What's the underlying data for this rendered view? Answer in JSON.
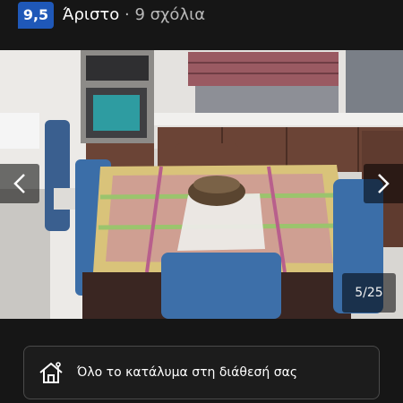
{
  "header": {
    "score": "9,5",
    "rating_word": "Άριστο",
    "separator": "·",
    "reviews": "9 σχόλια"
  },
  "gallery": {
    "counter": "5/25",
    "icons": {
      "prev": "chevron-left-icon",
      "next": "chevron-right-icon"
    }
  },
  "feature": {
    "text": "Όλο το κατάλυμα στη διάθεσή σας",
    "icon": "house-key-icon"
  },
  "colors": {
    "score_badge": "#1f58b8",
    "background": "#161616"
  }
}
